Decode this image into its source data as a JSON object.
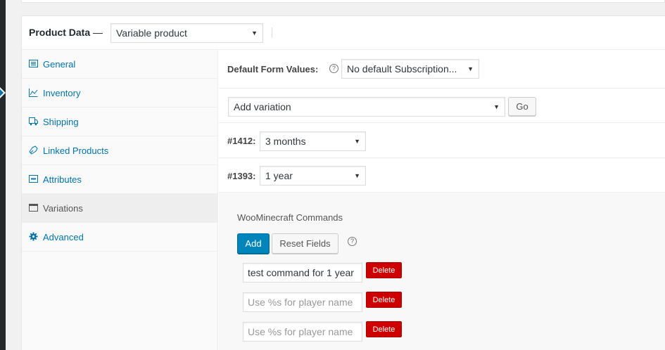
{
  "product_data": {
    "title": "Product Data",
    "separator": "—",
    "product_type": "Variable product"
  },
  "tabs": [
    {
      "label": "General",
      "icon": "general-icon"
    },
    {
      "label": "Inventory",
      "icon": "inventory-icon"
    },
    {
      "label": "Shipping",
      "icon": "shipping-icon"
    },
    {
      "label": "Linked Products",
      "icon": "link-icon"
    },
    {
      "label": "Attributes",
      "icon": "attributes-icon"
    },
    {
      "label": "Variations",
      "icon": "variations-icon",
      "active": true
    },
    {
      "label": "Advanced",
      "icon": "gear-icon"
    }
  ],
  "default_form": {
    "label": "Default Form Values:",
    "value": "No default Subscription..."
  },
  "add_variation": {
    "value": "Add variation",
    "go_label": "Go"
  },
  "variations": [
    {
      "id": "#1412:",
      "value": "3 months"
    },
    {
      "id": "#1393:",
      "value": "1 year"
    }
  ],
  "woominecraft": {
    "title": "WooMinecraft Commands",
    "add_label": "Add",
    "reset_label": "Reset Fields",
    "delete_label": "Delete",
    "placeholder": "Use %s for player name",
    "commands": [
      {
        "value": "test command for 1 year"
      },
      {
        "value": ""
      },
      {
        "value": ""
      }
    ]
  },
  "colors": {
    "accent": "#0073aa",
    "primary_button": "#0085ba",
    "delete_button": "#cc0000"
  }
}
